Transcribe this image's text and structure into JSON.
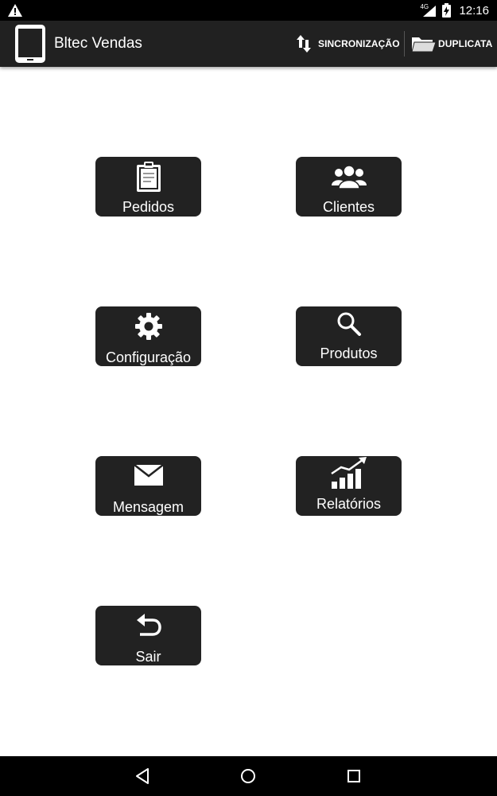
{
  "status_bar": {
    "network": "4G",
    "time": "12:16",
    "icons": [
      "warning-icon",
      "signal-icon",
      "battery-icon"
    ]
  },
  "action_bar": {
    "title": "Bltec Vendas",
    "app_icon": "tablet-icon",
    "actions": [
      {
        "label": "SINCRONIZAÇÃO",
        "icon": "sync-arrows-icon"
      },
      {
        "label": "DUPLICATA",
        "icon": "folder-icon"
      }
    ]
  },
  "menu": {
    "tiles": [
      {
        "label": "Pedidos",
        "icon": "clipboard-icon"
      },
      {
        "label": "Clientes",
        "icon": "users-icon"
      },
      {
        "label": "Configuração",
        "icon": "gear-icon"
      },
      {
        "label": "Produtos",
        "icon": "search-icon"
      },
      {
        "label": "Mensagem",
        "icon": "envelope-icon"
      },
      {
        "label": "Relatórios",
        "icon": "bar-chart-icon"
      },
      {
        "label": "Sair",
        "icon": "undo-arrow-icon"
      }
    ]
  },
  "nav_bar": {
    "buttons": [
      "back-icon",
      "home-icon",
      "recents-icon"
    ]
  },
  "colors": {
    "status_bar": "#000000",
    "action_bar": "#212121",
    "tile": "#222222",
    "background": "#ffffff",
    "text_light": "#ffffff"
  }
}
